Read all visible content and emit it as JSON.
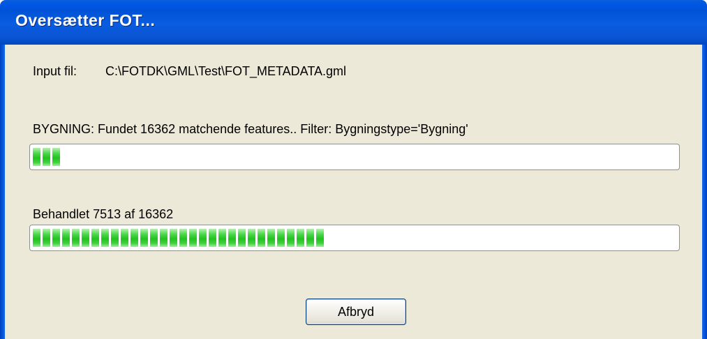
{
  "window": {
    "title": "Oversætter FOT..."
  },
  "input": {
    "label": "Input fil:",
    "path": "C:\\FOTDK\\GML\\Test\\FOT_METADATA.gml"
  },
  "feature_status": {
    "text": "BYGNING: Fundet 16362 matchende features.. Filter: Bygningstype='Bygning'",
    "progress_fraction": 0.05
  },
  "processing_status": {
    "text": "Behandlet 7513 af 16362",
    "progress_fraction": 0.4592
  },
  "buttons": {
    "cancel_label": "Afbryd"
  },
  "colors": {
    "titlebar": "#0054e3",
    "dialog_background": "#ece9d8",
    "progress_fill": "#22c320"
  }
}
